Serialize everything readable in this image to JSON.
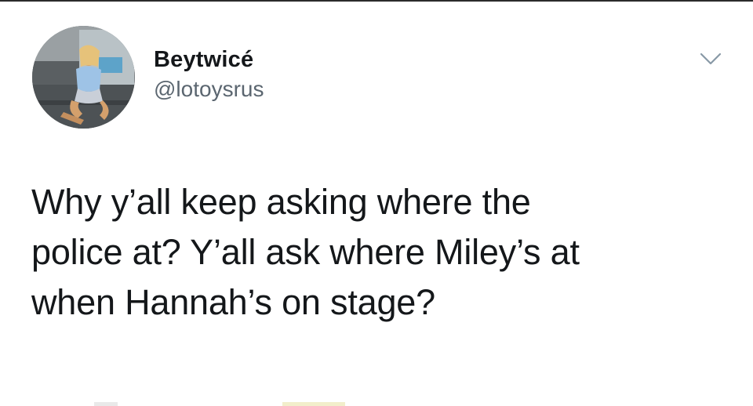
{
  "tweet": {
    "display_name": "Beytwicé",
    "handle": "@lotoysrus",
    "text": "Why y’all keep asking where the\npolice at? Y’all ask where Miley’s at\nwhen Hannah’s on stage?",
    "menu_icon": "chevron-down-icon",
    "avatar_icon": "avatar-photo"
  },
  "colors": {
    "text": "#14171a",
    "secondary_text": "#5b6670",
    "icon": "#8899a6",
    "background": "#ffffff"
  }
}
